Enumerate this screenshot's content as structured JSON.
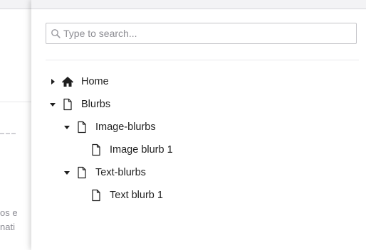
{
  "background": {
    "text_line1": "os e",
    "text_line2": "nati"
  },
  "search": {
    "placeholder": "Type to search...",
    "value": ""
  },
  "tree": {
    "items": [
      {
        "label": "Home",
        "icon": "home-icon",
        "expanded": false,
        "level": 0
      },
      {
        "label": "Blurbs",
        "icon": "document-icon",
        "expanded": true,
        "level": 0
      },
      {
        "label": "Image-blurbs",
        "icon": "document-icon",
        "expanded": true,
        "level": 1
      },
      {
        "label": "Image blurb 1",
        "icon": "document-icon",
        "level": 2
      },
      {
        "label": "Text-blurbs",
        "icon": "document-icon",
        "expanded": true,
        "level": 1
      },
      {
        "label": "Text blurb 1",
        "icon": "document-icon",
        "level": 2
      }
    ]
  }
}
